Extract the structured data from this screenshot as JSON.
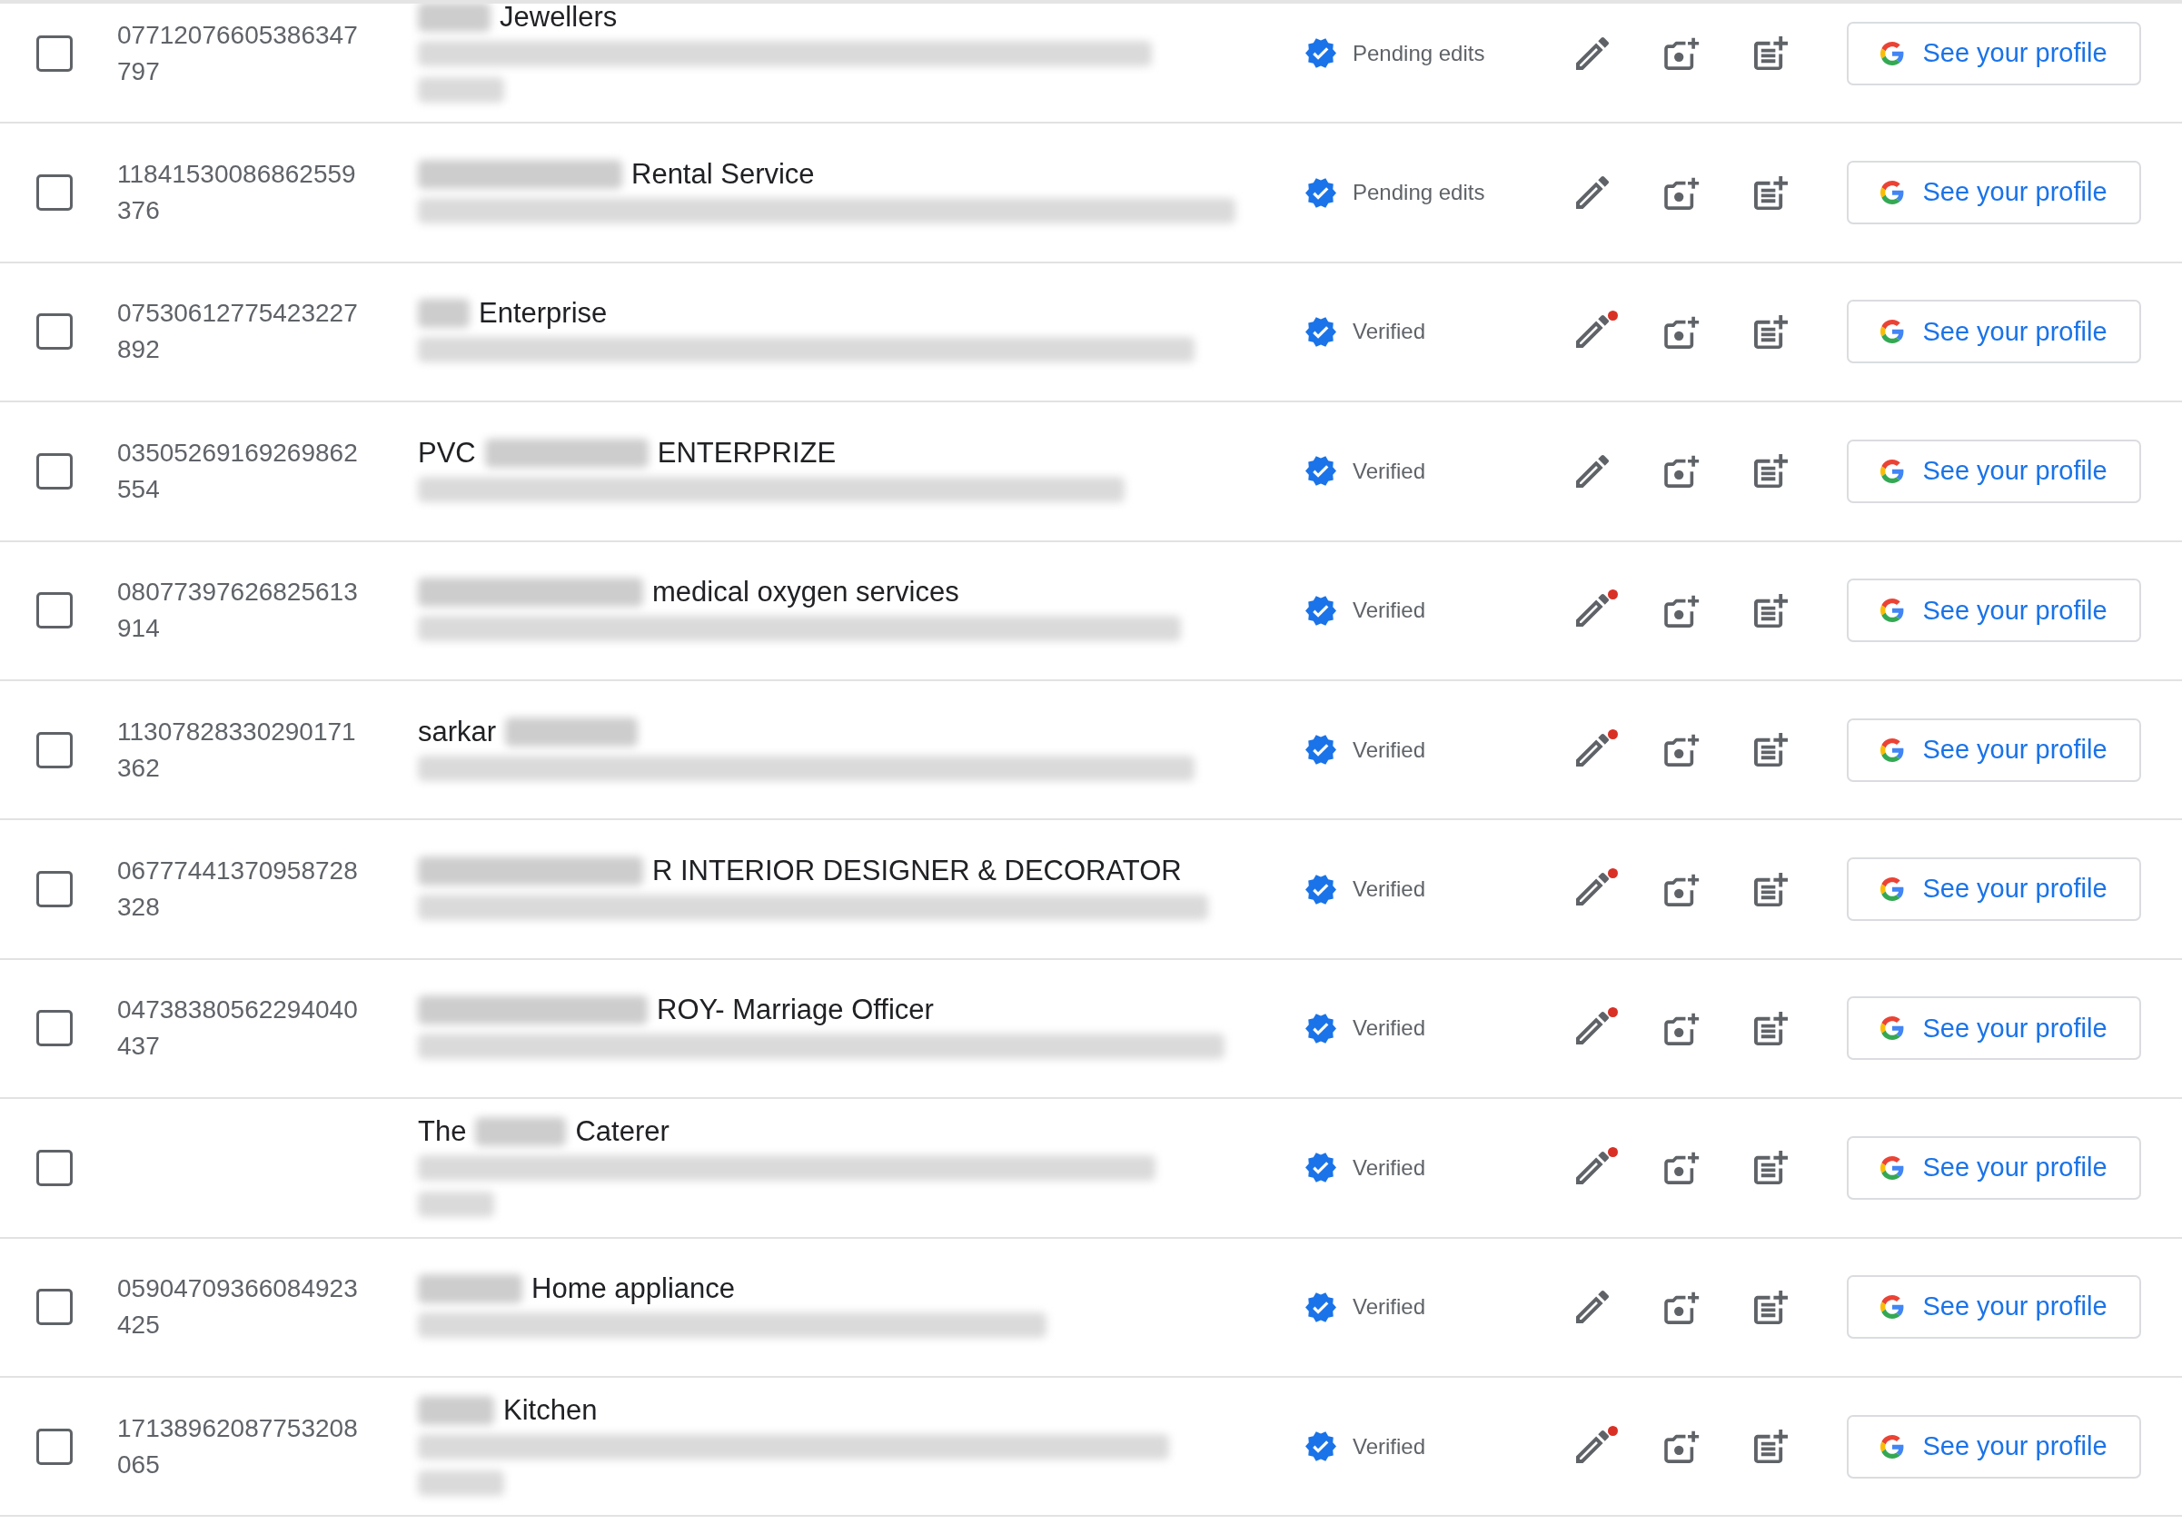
{
  "rows": [
    {
      "checked": false,
      "id": "07712076605386347797",
      "name_parts": [
        {
          "kind": "redacted"
        },
        {
          "kind": "text",
          "text": "Jewellers"
        }
      ],
      "address_lines": [
        {
          "kind": "redacted"
        },
        {
          "kind": "redacted"
        }
      ],
      "status": "Pending edits",
      "edit_notification": false,
      "button": "See your profile"
    },
    {
      "checked": false,
      "id": "11841530086862559376",
      "name_parts": [
        {
          "kind": "redacted"
        },
        {
          "kind": "text",
          "text": "Rental Service"
        }
      ],
      "address_lines": [
        {
          "kind": "redacted"
        }
      ],
      "status": "Pending edits",
      "edit_notification": false,
      "button": "See your profile"
    },
    {
      "checked": false,
      "id": "07530612775423227892",
      "name_parts": [
        {
          "kind": "redacted"
        },
        {
          "kind": "text",
          "text": "Enterprise"
        }
      ],
      "address_lines": [
        {
          "kind": "redacted"
        }
      ],
      "status": "Verified",
      "edit_notification": true,
      "button": "See your profile"
    },
    {
      "checked": false,
      "id": "03505269169269862554",
      "name_parts": [
        {
          "kind": "text",
          "text": "PVC"
        },
        {
          "kind": "redacted"
        },
        {
          "kind": "text",
          "text": "ENTERPRIZE"
        }
      ],
      "address_lines": [
        {
          "kind": "redacted"
        }
      ],
      "status": "Verified",
      "edit_notification": false,
      "button": "See your profile"
    },
    {
      "checked": false,
      "id": "08077397626825613914",
      "name_parts": [
        {
          "kind": "redacted"
        },
        {
          "kind": "text",
          "text": "medical oxygen services"
        }
      ],
      "address_lines": [
        {
          "kind": "redacted"
        }
      ],
      "status": "Verified",
      "edit_notification": true,
      "button": "See your profile"
    },
    {
      "checked": false,
      "id": "11307828330290171362",
      "name_parts": [
        {
          "kind": "text",
          "text": "sarkar"
        },
        {
          "kind": "redacted"
        }
      ],
      "address_lines": [
        {
          "kind": "redacted"
        }
      ],
      "status": "Verified",
      "edit_notification": true,
      "button": "See your profile"
    },
    {
      "checked": false,
      "id": "06777441370958728328",
      "name_parts": [
        {
          "kind": "redacted"
        },
        {
          "kind": "text",
          "text": "R INTERIOR DESIGNER & DECORATOR"
        }
      ],
      "address_lines": [
        {
          "kind": "redacted"
        }
      ],
      "status": "Verified",
      "edit_notification": true,
      "button": "See your profile"
    },
    {
      "checked": false,
      "id": "04738380562294040437",
      "name_parts": [
        {
          "kind": "redacted"
        },
        {
          "kind": "text",
          "text": "ROY- Marriage Officer"
        }
      ],
      "address_lines": [
        {
          "kind": "redacted"
        }
      ],
      "status": "Verified",
      "edit_notification": true,
      "button": "See your profile"
    },
    {
      "checked": false,
      "name_parts": [
        {
          "kind": "text",
          "text": "The"
        },
        {
          "kind": "redacted"
        },
        {
          "kind": "text",
          "text": "Caterer"
        }
      ],
      "address_lines": [
        {
          "kind": "redacted"
        },
        {
          "kind": "redacted"
        }
      ],
      "status": "Verified",
      "edit_notification": true,
      "button": "See your profile"
    },
    {
      "checked": false,
      "id": "05904709366084923425",
      "name_parts": [
        {
          "kind": "redacted"
        },
        {
          "kind": "text",
          "text": "Home appliance"
        }
      ],
      "address_lines": [
        {
          "kind": "redacted"
        }
      ],
      "status": "Verified",
      "edit_notification": false,
      "button": "See your profile"
    },
    {
      "checked": false,
      "id": "17138962087753208065",
      "name_parts": [
        {
          "kind": "redacted"
        },
        {
          "kind": "text",
          "text": "Kitchen"
        }
      ],
      "address_lines": [
        {
          "kind": "redacted"
        },
        {
          "kind": "redacted"
        }
      ],
      "status": "Verified",
      "edit_notification": true,
      "button": "See your profile"
    }
  ]
}
